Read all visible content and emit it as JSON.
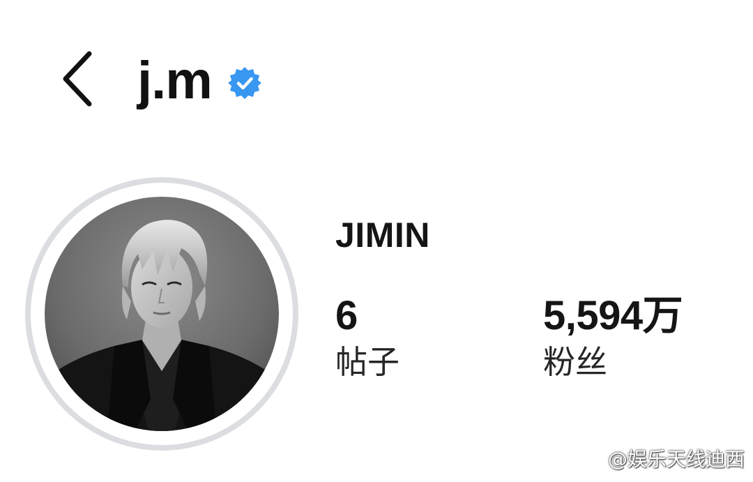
{
  "header": {
    "username": "j.m",
    "back_icon": "chevron-left-icon",
    "verified_icon": "verified-badge-icon",
    "verified_color": "#3897f0"
  },
  "profile": {
    "avatar_icon": "profile-photo",
    "ring_color": "#dcdde1",
    "display_name": "JIMIN",
    "stats": {
      "posts": {
        "value": "6",
        "label": "帖子"
      },
      "followers": {
        "value": "5,594万",
        "label": "粉丝"
      }
    }
  },
  "watermark": {
    "text": "@娱乐天线迪西",
    "icon": "weibo-logo-icon"
  }
}
